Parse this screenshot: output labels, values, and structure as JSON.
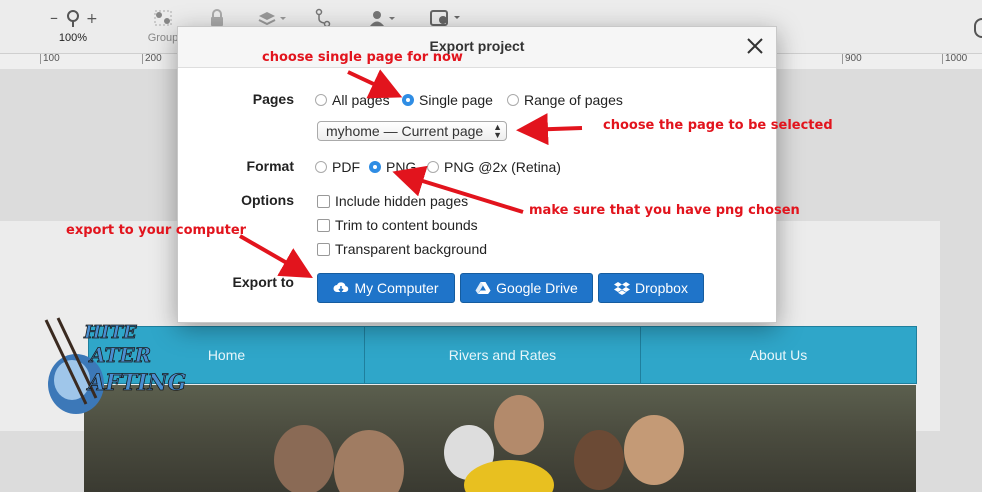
{
  "toolbar": {
    "zoom_label": "100%",
    "group_label": "Group"
  },
  "ruler": {
    "ticks": [
      "100",
      "200",
      "900",
      "1000"
    ]
  },
  "dialog": {
    "title": "Export project",
    "pages": {
      "label": "Pages",
      "options": [
        "All pages",
        "Single page",
        "Range of pages"
      ],
      "selected": "Single page"
    },
    "page_select": {
      "value": "myhome — Current page"
    },
    "format": {
      "label": "Format",
      "options": [
        "PDF",
        "PNG",
        "PNG @2x (Retina)"
      ],
      "selected": "PNG"
    },
    "options": {
      "label": "Options",
      "items": [
        "Include hidden pages",
        "Trim to content bounds",
        "Transparent background"
      ]
    },
    "export_to": {
      "label": "Export to",
      "buttons": [
        "My Computer",
        "Google Drive",
        "Dropbox"
      ]
    }
  },
  "site": {
    "nav": [
      "Home",
      "Rivers and Rates",
      "About Us"
    ],
    "logo_text": "WHITE WATER RAFTING"
  },
  "annotations": {
    "single_page": "choose single page for now",
    "page_select": "choose the page to be selected",
    "png": "make sure that you have png chosen",
    "export": "export to your computer"
  },
  "colors": {
    "accent": "#1f74c9",
    "annotation": "#e2141d",
    "nav": "#2fa6c9"
  }
}
